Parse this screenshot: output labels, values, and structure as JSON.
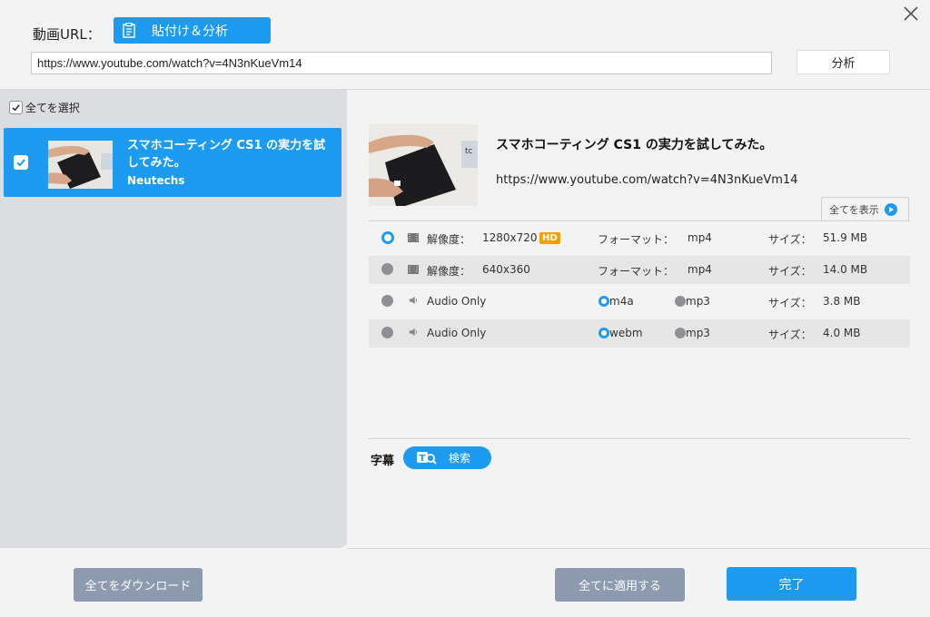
{
  "header": {
    "url_label": "動画URL：",
    "paste_button": "貼付け＆分析",
    "url_value": "https://www.youtube.com/watch?v=4N3nKueVm14",
    "analyze_button": "分析"
  },
  "sidebar": {
    "select_all": "全てを選択",
    "items": [
      {
        "title": "スマホコーティング CS1 の実力を試してみた。",
        "channel": "Neutechs",
        "checked": true
      }
    ]
  },
  "detail": {
    "title": "スマホコーティング CS1 の実力を試してみた。",
    "url": "https://www.youtube.com/watch?v=4N3nKueVm14",
    "show_all": "全てを表示",
    "formats": [
      {
        "label": "解像度：",
        "value": "1280x720",
        "badge": "HD",
        "fmt_label": "フォーマット：",
        "fmt": "mp4",
        "size_label": "サイズ：",
        "size": "51.9 MB",
        "selected": true
      },
      {
        "label": "解像度：",
        "value": "640x360",
        "fmt_label": "フォーマット：",
        "fmt": "mp4",
        "size_label": "サイズ：",
        "size": "14.0 MB",
        "selected": false
      },
      {
        "label": "Audio Only",
        "opt1": "m4a",
        "opt2": "mp3",
        "size_label": "サイズ：",
        "size": "3.8 MB",
        "selected": false
      },
      {
        "label": "Audio Only",
        "opt1": "webm",
        "opt2": "mp3",
        "size_label": "サイズ：",
        "size": "4.0 MB",
        "selected": false
      }
    ],
    "subtitle_label": "字幕",
    "search_button": "検索"
  },
  "footer": {
    "download_all": "全てをダウンロード",
    "apply_all": "全てに適用する",
    "done": "完了"
  },
  "colors": {
    "accent": "#1c9bf0",
    "gray_button": "#8d9ab0",
    "hd_badge": "#f2a100"
  }
}
